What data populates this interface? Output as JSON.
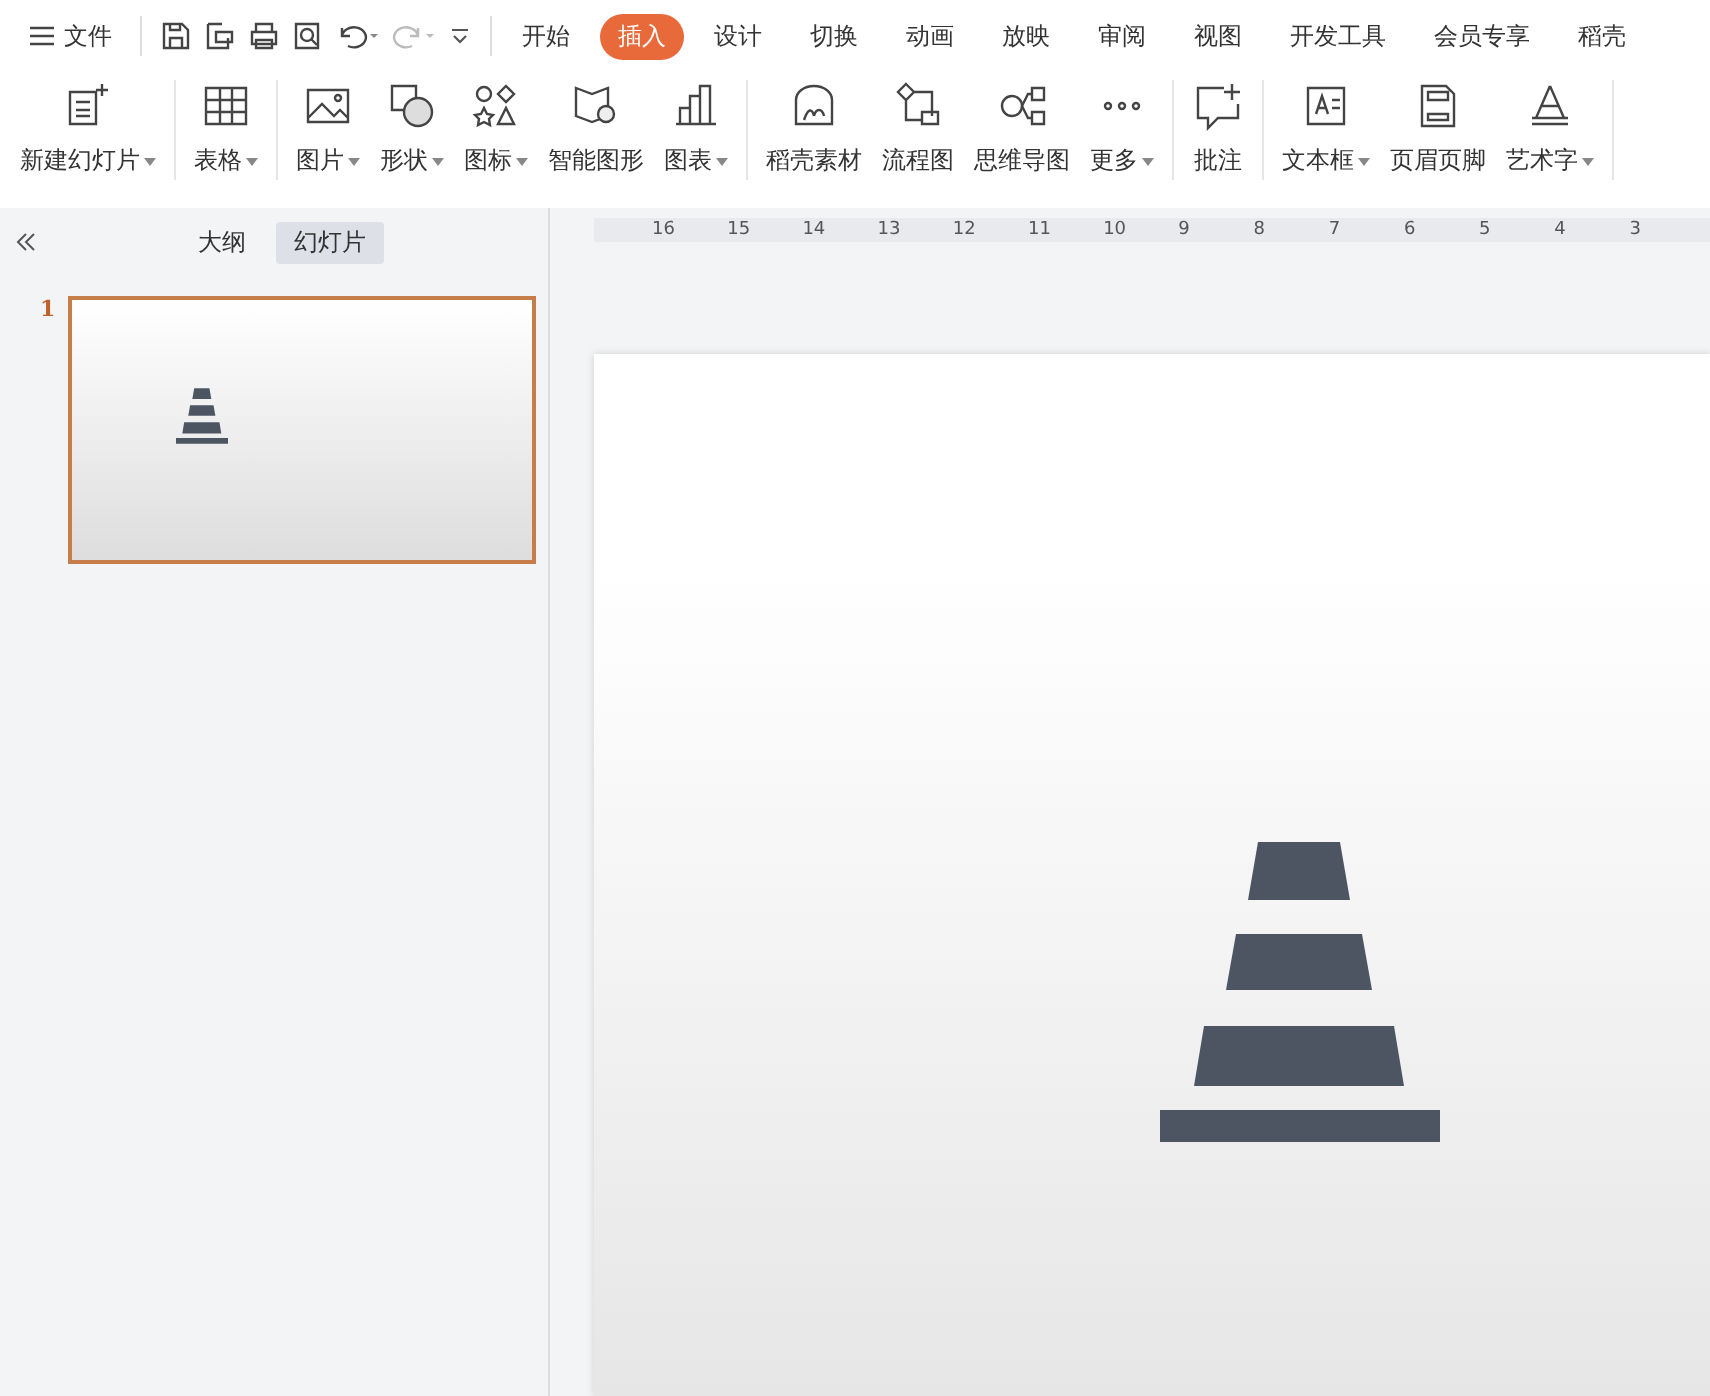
{
  "menu": {
    "file": "文件",
    "tabs": [
      {
        "label": "开始",
        "selected": false
      },
      {
        "label": "插入",
        "selected": true
      },
      {
        "label": "设计",
        "selected": false
      },
      {
        "label": "切换",
        "selected": false
      },
      {
        "label": "动画",
        "selected": false
      },
      {
        "label": "放映",
        "selected": false
      },
      {
        "label": "审阅",
        "selected": false
      },
      {
        "label": "视图",
        "selected": false
      },
      {
        "label": "开发工具",
        "selected": false
      },
      {
        "label": "会员专享",
        "selected": false
      },
      {
        "label": "稻壳",
        "selected": false
      }
    ]
  },
  "ribbon": [
    [
      {
        "label": "新建幻灯片",
        "dropdown": true
      }
    ],
    [
      {
        "label": "表格",
        "dropdown": true
      }
    ],
    [
      {
        "label": "图片",
        "dropdown": true
      },
      {
        "label": "形状",
        "dropdown": true
      },
      {
        "label": "图标",
        "dropdown": true
      },
      {
        "label": "智能图形",
        "dropdown": false
      },
      {
        "label": "图表",
        "dropdown": true
      }
    ],
    [
      {
        "label": "稻壳素材",
        "dropdown": false
      },
      {
        "label": "流程图",
        "dropdown": false
      },
      {
        "label": "思维导图",
        "dropdown": false
      },
      {
        "label": "更多",
        "dropdown": true
      }
    ],
    [
      {
        "label": "批注",
        "dropdown": false
      }
    ],
    [
      {
        "label": "文本框",
        "dropdown": true
      },
      {
        "label": "页眉页脚",
        "dropdown": false
      },
      {
        "label": "艺术字",
        "dropdown": true
      }
    ]
  ],
  "panel": {
    "tabs": [
      {
        "label": "大纲",
        "selected": false
      },
      {
        "label": "幻灯片",
        "selected": true
      }
    ],
    "slides": [
      {
        "number": "1",
        "selected": true
      }
    ]
  },
  "ruler": [
    "16",
    "15",
    "14",
    "13",
    "12",
    "11",
    "10",
    "9",
    "8",
    "7",
    "6",
    "5",
    "4",
    "3"
  ]
}
